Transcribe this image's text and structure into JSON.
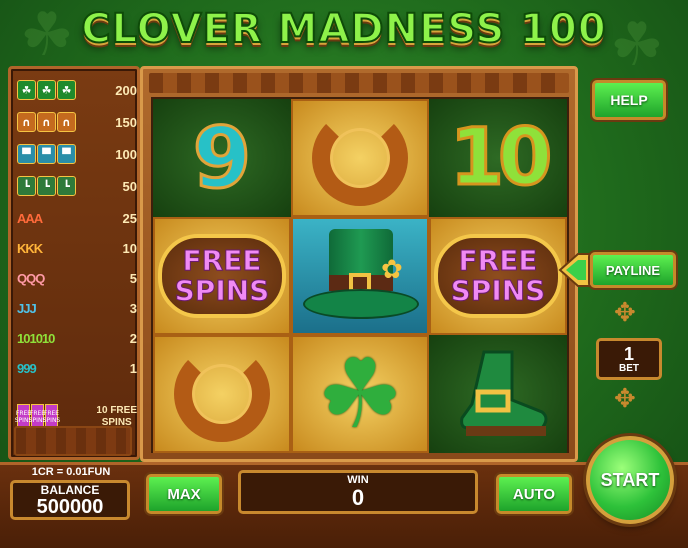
{
  "game": {
    "title": "CLOVER MADNESS 100"
  },
  "paytable": {
    "rows": [
      {
        "symbol": "clover",
        "payout": "200"
      },
      {
        "symbol": "horseshoe",
        "payout": "150"
      },
      {
        "symbol": "hat",
        "payout": "100"
      },
      {
        "symbol": "boot",
        "payout": "50"
      },
      {
        "symbol": "AAA",
        "payout": "25"
      },
      {
        "symbol": "KKK",
        "payout": "10"
      },
      {
        "symbol": "QQQ",
        "payout": "5"
      },
      {
        "symbol": "JJJ",
        "payout": "3"
      },
      {
        "symbol": "101010",
        "payout": "2"
      },
      {
        "symbol": "999",
        "payout": "1"
      }
    ],
    "free_spins": {
      "icon_text": "FREE SPINS",
      "label_line1": "10 FREE",
      "label_line2": "SPINS"
    }
  },
  "reels": {
    "grid": [
      [
        "9",
        "horseshoe",
        "10"
      ],
      [
        "FREE SPINS",
        "hat",
        "FREE SPINS"
      ],
      [
        "horseshoe",
        "clover",
        "boot"
      ]
    ],
    "free_spins_line1": "FREE",
    "free_spins_line2": "SPINS",
    "nine": "9",
    "ten": "10"
  },
  "controls": {
    "help": "HELP",
    "payline": "PAYLINE",
    "bet_value": "1",
    "bet_label": "BET",
    "max": "MAX",
    "auto": "AUTO",
    "start": "START"
  },
  "status": {
    "credit_rate": "1CR = 0.01FUN",
    "balance_label": "BALANCE",
    "balance_value": "500000",
    "win_label": "WIN",
    "win_value": "0"
  },
  "colors": {
    "accent_green": "#5df050",
    "wood": "#7a3b12",
    "gold": "#c8892e",
    "free_spins_pink": "#f08af4"
  }
}
